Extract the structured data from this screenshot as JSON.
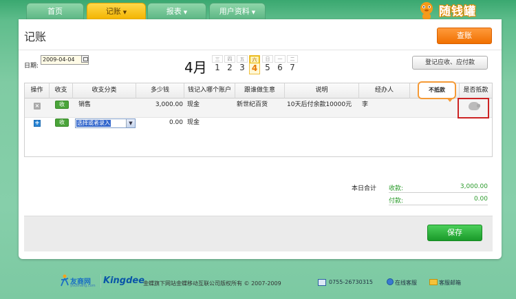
{
  "nav": {
    "tabs": [
      {
        "label": "首页",
        "active": false,
        "dropdown": false
      },
      {
        "label": "记账",
        "active": true,
        "dropdown": true
      },
      {
        "label": "报表",
        "active": false,
        "dropdown": true
      },
      {
        "label": "用户资料",
        "active": false,
        "dropdown": true
      }
    ],
    "brand_text": "随钱罐"
  },
  "page": {
    "title": "记账",
    "view_button": "查账",
    "date_label": "日期:",
    "date_value": "2009-04-04",
    "month": "4月",
    "week": [
      {
        "weekday": "三",
        "day": "1",
        "today": false
      },
      {
        "weekday": "四",
        "day": "2",
        "today": false
      },
      {
        "weekday": "五",
        "day": "3",
        "today": false
      },
      {
        "weekday": "六",
        "day": "4",
        "today": true
      },
      {
        "weekday": "日",
        "day": "5",
        "today": false
      },
      {
        "weekday": "一",
        "day": "6",
        "today": false
      },
      {
        "weekday": "二",
        "day": "7",
        "today": false
      }
    ],
    "ar_button": "登记应收、应付款"
  },
  "table": {
    "headers": [
      "操作",
      "收支",
      "收支分类",
      "多少钱",
      "钱记入哪个账户",
      "跟谁做生意",
      "说明",
      "经办人",
      "",
      "是否抵款"
    ],
    "rows": [
      {
        "type_badge": "收",
        "category": "销售",
        "amount": "3,000.00",
        "account": "现金",
        "partner": "新世纪百货",
        "note": "10天后付余款10000元",
        "handler": "李"
      }
    ],
    "new_row": {
      "type_badge": "收",
      "category_placeholder": "选择或者录入",
      "amount": "0.00",
      "account": "现金"
    },
    "tooltip": "不抵款"
  },
  "summary": {
    "day_total_label": "本日合计",
    "income_label": "收款:",
    "income_value": "3,000.00",
    "expense_label": "付款:",
    "expense_value": "0.00"
  },
  "actions": {
    "save": "保存"
  },
  "footer": {
    "partner_logo": "友商网",
    "partner_sub": "youshang.com",
    "kingdee": "Kingdee",
    "copyright": "金蝶旗下网站金蝶移动互联公司版权所有 © 2007-2009",
    "phone": "0755-26730315",
    "support": "在线客服",
    "mail": "客服邮箱"
  }
}
